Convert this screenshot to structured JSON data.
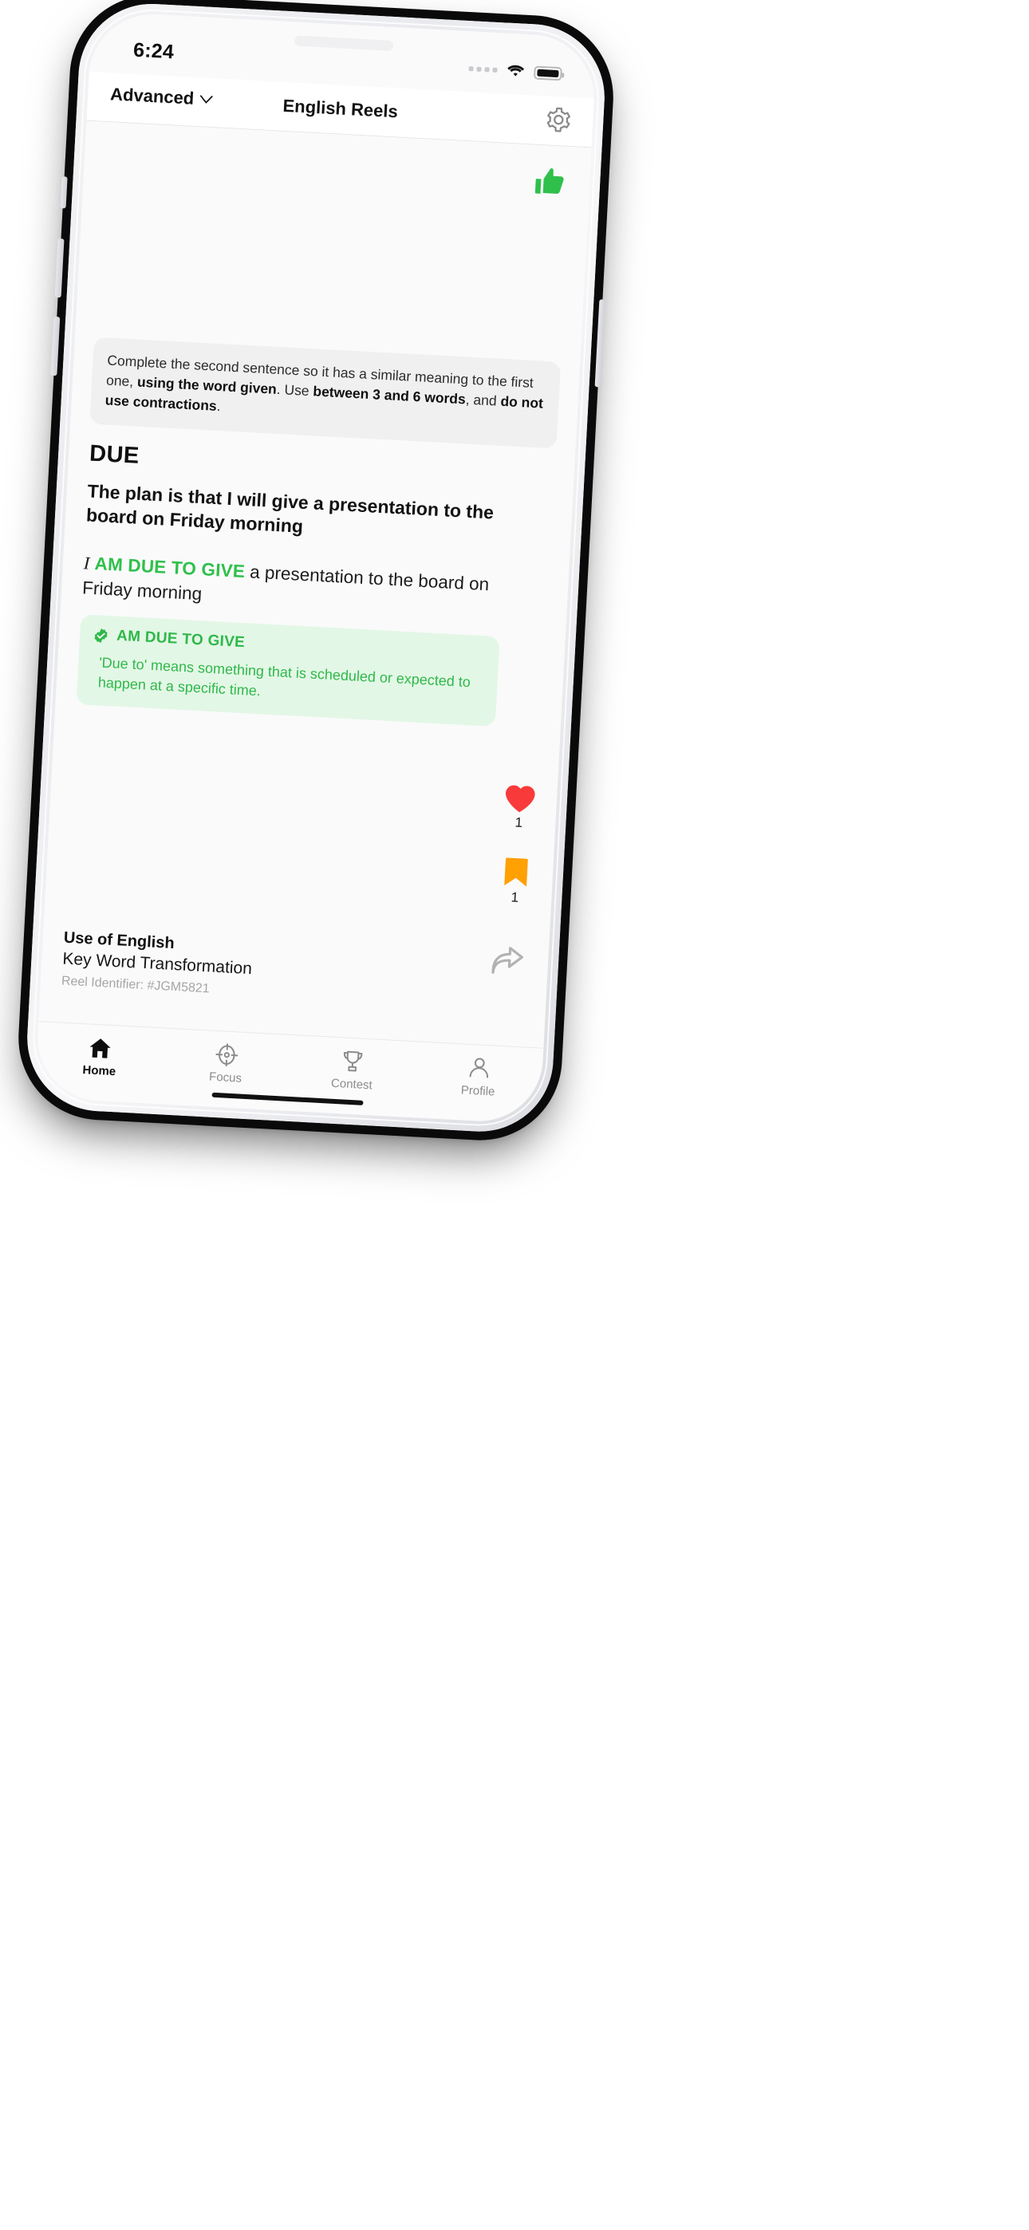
{
  "status_bar": {
    "time": "6:24",
    "signal_icon": "signal-dots-icon",
    "wifi_icon": "wifi-icon",
    "battery_icon": "battery-icon"
  },
  "nav": {
    "level_label": "Advanced",
    "level_chevron_icon": "chevron-down-icon",
    "title": "English Reels",
    "settings_icon": "gear-icon"
  },
  "reel": {
    "reaction_icon": "thumbs-up-icon",
    "instruction": {
      "part1": "Complete the second sentence so it has a similar meaning to the first one, ",
      "bold1": "using the word given",
      "part2": ". Use ",
      "bold2": "between 3 and 6 words",
      "part3": ", and ",
      "bold3": "do not use contractions",
      "part4": "."
    },
    "keyword": "DUE",
    "prompt": "The plan is that I will give a presentation to the board on Friday morning",
    "answer": {
      "prefix": "I",
      "highlight": "AM DUE TO GIVE",
      "suffix": "a presentation to the board on Friday morning"
    },
    "explanation": {
      "badge_icon": "verified-check-icon",
      "title": "AM DUE TO GIVE",
      "text": "'Due to' means something that is scheduled or expected to happen at a specific time."
    },
    "actions": {
      "like_icon": "heart-icon",
      "like_count": "1",
      "bookmark_icon": "bookmark-icon",
      "bookmark_count": "1",
      "share_icon": "share-arrow-icon"
    },
    "meta": {
      "skill": "Use of English",
      "type": "Key Word Transformation",
      "identifier": "Reel Identifier: #JGM5821"
    }
  },
  "tabs": [
    {
      "label": "Home",
      "icon": "home-icon",
      "active": true
    },
    {
      "label": "Focus",
      "icon": "target-icon",
      "active": false
    },
    {
      "label": "Contest",
      "icon": "trophy-icon",
      "active": false
    },
    {
      "label": "Profile",
      "icon": "person-icon",
      "active": false
    }
  ],
  "colors": {
    "accent_green": "#2fc04c",
    "explain_bg": "#e3f7e6",
    "like_red": "#f93a3a",
    "bookmark_orange": "#ffa003",
    "instruction_bg": "#f0f0f0"
  }
}
